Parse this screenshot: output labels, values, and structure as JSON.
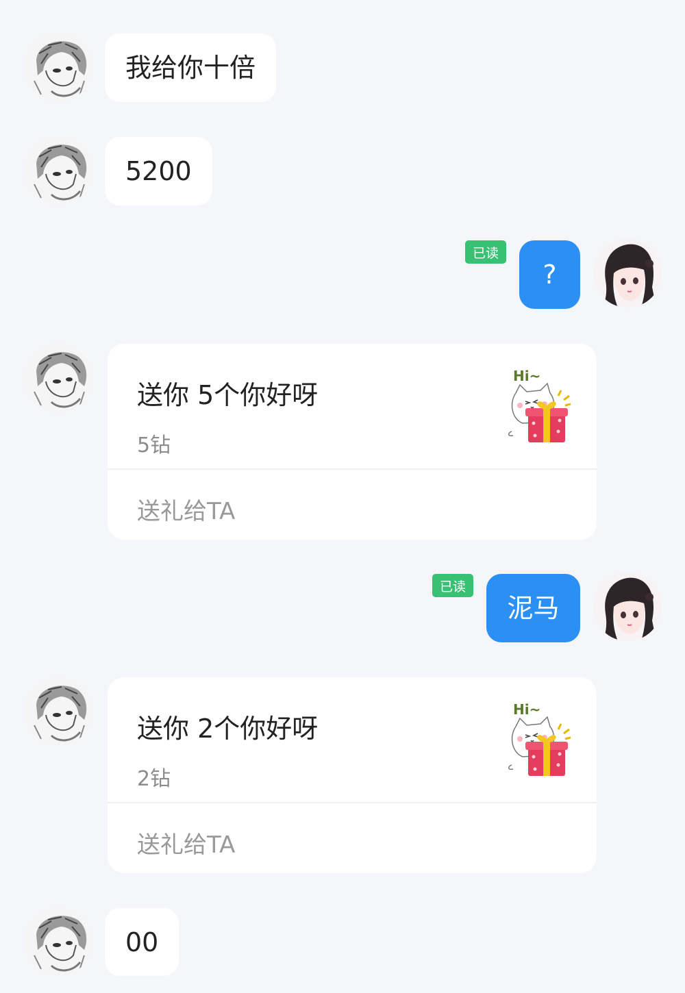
{
  "messages": [
    {
      "text": "我给你十倍"
    },
    {
      "text": "5200"
    },
    {
      "text": "?",
      "read": "已读"
    },
    {
      "gift_name": "送你 5个你好呀",
      "price": "5钻",
      "action": "送礼给TA",
      "sticker_text": "Hi~"
    },
    {
      "text": "泥马",
      "read": "已读"
    },
    {
      "gift_name": "送你 2个你好呀",
      "price": "2钻",
      "action": "送礼给TA",
      "sticker_text": "Hi~"
    },
    {
      "text": "00"
    }
  ],
  "colors": {
    "background": "#f4f6f9",
    "incoming_bubble": "#ffffff",
    "outgoing_bubble": "#2b8ff4",
    "read_badge": "#38c172"
  },
  "icons": {
    "sender_avatar": "sketch-portrait-avatar",
    "self_avatar": "anime-girl-avatar",
    "gift_sticker": "cat-with-gift-sticker"
  }
}
